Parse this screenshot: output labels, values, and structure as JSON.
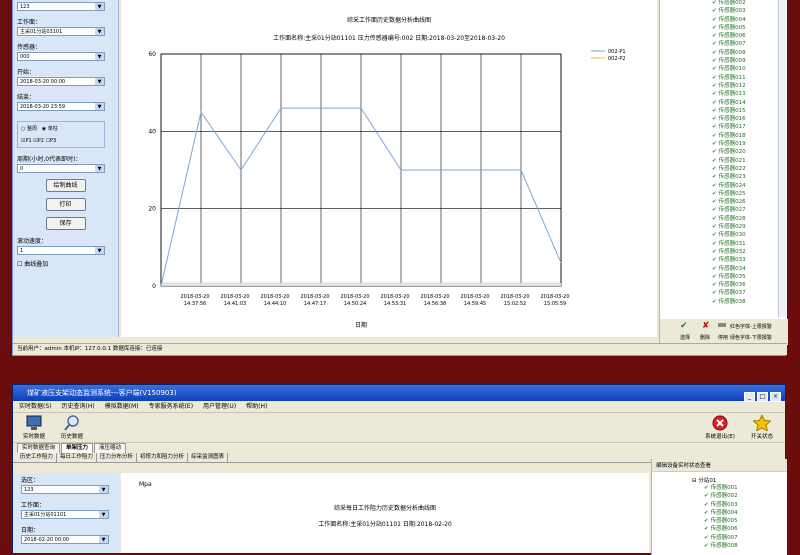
{
  "top": {
    "left": {
      "area_value": "123",
      "face_label": "工作面：",
      "face_value": "主采01分站03101",
      "sensor_label": "传感器：",
      "sensor_value": "000",
      "start_label": "开始：",
      "start_value": "2018-03-20 00:00",
      "end_label": "结束：",
      "end_value": "2018-03-20 23:59",
      "opt_cycle": "整周",
      "opt_single": "单柱",
      "chk_p1": "P1",
      "chk_p2": "P2",
      "chk_p3": "P3",
      "cycle_label": "周期(小时,0代表即时)：",
      "cycle_value": "0",
      "btn_draw": "绘制曲线",
      "btn_print": "打印",
      "btn_save": "保存",
      "speed_label": "滚动速度：",
      "speed_value": "1",
      "overlay_label": "曲线叠加"
    },
    "status_text": "当前用户：admin  本机IP：127.0.0.1  数据库连接：已连接",
    "right_legend": {
      "red": "红色字体-上限报警",
      "green": "绿色字体-下限报警",
      "btn_select": "选择",
      "btn_delete": "删除",
      "btn_stop": "停用"
    },
    "sensors": [
      "传感器002",
      "传感器003",
      "传感器004",
      "传感器005",
      "传感器006",
      "传感器007",
      "传感器008",
      "传感器009",
      "传感器010",
      "传感器011",
      "传感器012",
      "传感器013",
      "传感器014",
      "传感器015",
      "传感器016",
      "传感器017",
      "传感器018",
      "传感器019",
      "传感器020",
      "传感器021",
      "传感器022",
      "传感器023",
      "传感器024",
      "传感器025",
      "传感器026",
      "传感器027",
      "传感器028",
      "传感器029",
      "传感器030",
      "传感器031",
      "传感器032",
      "传感器033",
      "传感器034",
      "传感器035",
      "传感器036",
      "传感器037",
      "传感器038"
    ]
  },
  "chart_data": {
    "type": "line",
    "title": "综采工作面历史数据分析曲线图",
    "subtitle": "工作面名称:主采01分站01101  压力传感器编号:002  日期:2018-03-20至2018-03-20",
    "xlabel": "日期",
    "ylabel": "",
    "ylim": [
      0,
      60
    ],
    "yticks": [
      0,
      20,
      40,
      60
    ],
    "x": [
      "2018-03-20 14:37:56",
      "2018-03-20 14:41:03",
      "2018-03-20 14:44:10",
      "2018-03-20 14:47:17",
      "2018-03-20 14:50:24",
      "2018-03-20 14:53:31",
      "2018-03-20 14:56:38",
      "2018-03-20 14:59:45",
      "2018-03-20 15:02:52",
      "2018-03-20 15:05:59"
    ],
    "legend_position": "top-right",
    "series": [
      {
        "name": "002-P1",
        "color": "#7fa7d4",
        "points": [
          [
            0,
            0
          ],
          [
            1,
            45
          ],
          [
            2,
            30
          ],
          [
            3,
            46
          ],
          [
            5,
            46
          ],
          [
            6,
            30
          ],
          [
            9,
            30
          ],
          [
            10,
            6
          ]
        ]
      },
      {
        "name": "002-P2",
        "color": "#e6b84a",
        "points": []
      }
    ]
  },
  "bottom": {
    "title": "煤矿液压支架动态监测系统---客户端(V150903)",
    "menu": [
      "实时数据(S)",
      "历史查询(H)",
      "模拟数据(M)",
      "专家服务系统(E)",
      "用户管理(U)",
      "帮助(H)"
    ],
    "tool_realtime": "实时数据",
    "tool_history": "历史数据",
    "tool_exit": "系统退出(E)",
    "tool_start": "开关状态",
    "tabs1": [
      "实时数据查询",
      "单架压力",
      "液压缩动"
    ],
    "tabs2": [
      "历史工作阻力",
      "每日工作阻力",
      "压力分布分析",
      "初撑力和阻力分析",
      "综采监测图表"
    ],
    "area_label": "选区：",
    "area_value": "123",
    "face_label": "工作面：",
    "face_value": "主采01分站01101",
    "date_label": "日期：",
    "date_value": "2018-02-20 00:00",
    "unit": "Mpa",
    "chart_title": "综采每日工作阻力历史数据分析曲线图",
    "chart_subtitle": "工作面名称:主采01分站01101  日期:2018-02-20",
    "right_title": "编辑设备实时状态查看",
    "right_root": "分站01",
    "right_items": [
      "传感器001",
      "传感器002",
      "传感器003",
      "传感器004",
      "传感器005",
      "传感器006",
      "传感器007",
      "传感器008"
    ]
  }
}
